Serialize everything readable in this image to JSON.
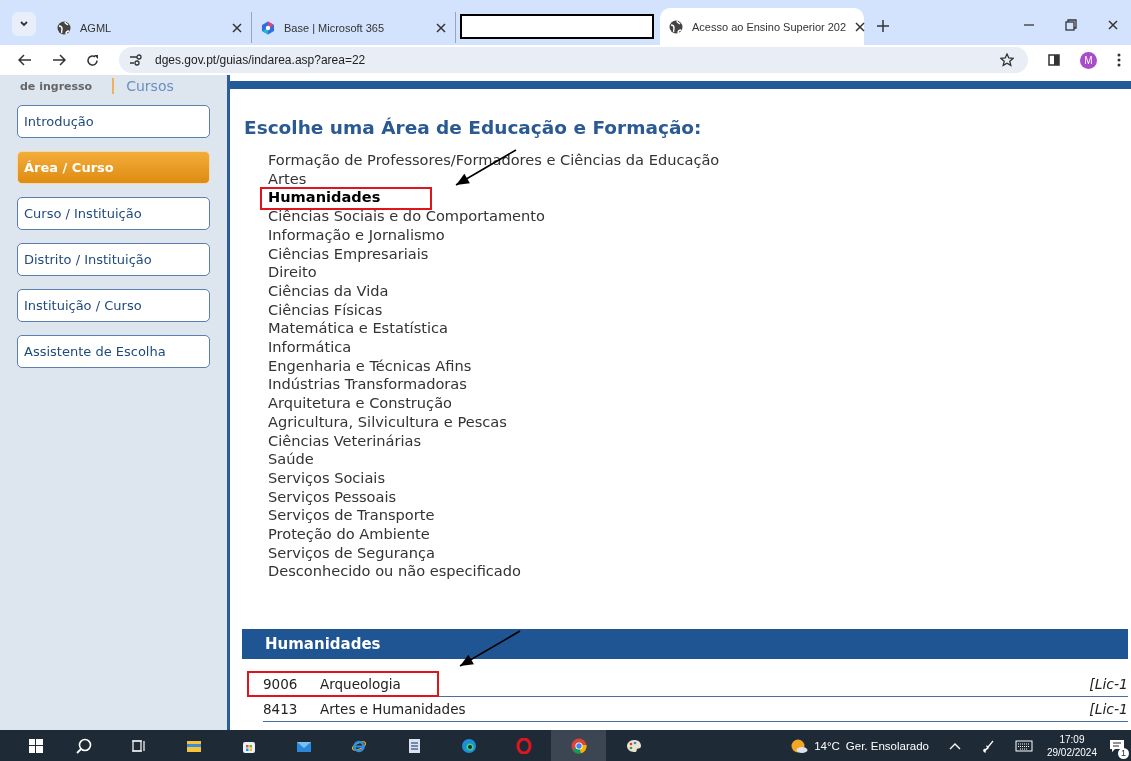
{
  "browser": {
    "tabs": [
      {
        "kind": "page",
        "title": "AGML",
        "selected": false
      },
      {
        "kind": "page",
        "title": "Base | Microsoft 365",
        "selected": false
      },
      {
        "kind": "redacted",
        "selected": false
      },
      {
        "kind": "page",
        "title": "Acesso ao Ensino Superior 202",
        "selected": true
      }
    ],
    "address": "dges.gov.pt/guias/indarea.asp?area=22",
    "profile": "M"
  },
  "sidebar": {
    "logo": [
      "de ingresso",
      "Cursos"
    ],
    "items": [
      {
        "label": "Introdução",
        "selected": false
      },
      {
        "label": "Área / Curso",
        "selected": true
      },
      {
        "label": "Curso / Instituição",
        "selected": false
      },
      {
        "label": "Distrito / Instituição",
        "selected": false
      },
      {
        "label": "Instituição / Curso",
        "selected": false
      },
      {
        "label": "Assistente de Escolha",
        "selected": false
      }
    ]
  },
  "main": {
    "heading": "Escolhe uma Área de Educação e Formação:",
    "areas": [
      {
        "label": "Formação de Professores/Formadores e Ciências da Educação",
        "selected": false,
        "highlighted": false
      },
      {
        "label": "Artes",
        "selected": false,
        "highlighted": false
      },
      {
        "label": "Humanidades",
        "selected": true,
        "highlighted": true
      },
      {
        "label": "Ciências Sociais e do Comportamento",
        "selected": false,
        "highlighted": false
      },
      {
        "label": "Informação e Jornalismo",
        "selected": false,
        "highlighted": false
      },
      {
        "label": "Ciências Empresariais",
        "selected": false,
        "highlighted": false
      },
      {
        "label": "Direito",
        "selected": false,
        "highlighted": false
      },
      {
        "label": "Ciências da Vida",
        "selected": false,
        "highlighted": false
      },
      {
        "label": "Ciências Físicas",
        "selected": false,
        "highlighted": false
      },
      {
        "label": "Matemática e Estatística",
        "selected": false,
        "highlighted": false
      },
      {
        "label": "Informática",
        "selected": false,
        "highlighted": false
      },
      {
        "label": "Engenharia e Técnicas Afins",
        "selected": false,
        "highlighted": false
      },
      {
        "label": "Indústrias Transformadoras",
        "selected": false,
        "highlighted": false
      },
      {
        "label": "Arquitetura e Construção",
        "selected": false,
        "highlighted": false
      },
      {
        "label": "Agricultura, Silvicultura e Pescas",
        "selected": false,
        "highlighted": false
      },
      {
        "label": "Ciências Veterinárias",
        "selected": false,
        "highlighted": false
      },
      {
        "label": "Saúde",
        "selected": false,
        "highlighted": false
      },
      {
        "label": "Serviços Sociais",
        "selected": false,
        "highlighted": false
      },
      {
        "label": "Serviços Pessoais",
        "selected": false,
        "highlighted": false
      },
      {
        "label": "Serviços de Transporte",
        "selected": false,
        "highlighted": false
      },
      {
        "label": "Proteção do Ambiente",
        "selected": false,
        "highlighted": false
      },
      {
        "label": "Serviços de Segurança",
        "selected": false,
        "highlighted": false
      },
      {
        "label": "Desconhecido ou não especificado",
        "selected": false,
        "highlighted": false
      }
    ],
    "section": {
      "title": "Humanidades",
      "rows": [
        {
          "code": "9006",
          "name": "Arqueologia",
          "degree": "[Lic-1",
          "highlighted": true
        },
        {
          "code": "8413",
          "name": "Artes e Humanidades",
          "degree": "[Lic-1",
          "highlighted": false
        }
      ]
    }
  },
  "taskbar": {
    "weather": {
      "temp": "14°C",
      "condition": "Ger. Ensolarado"
    },
    "time": "17:09",
    "date": "29/02/2024",
    "notifications": "1"
  }
}
